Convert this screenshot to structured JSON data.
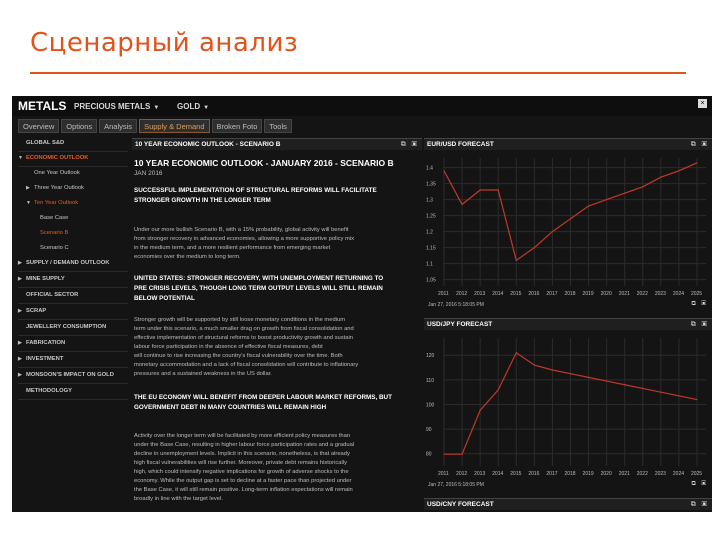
{
  "slide": {
    "title": "Сценарный анализ"
  },
  "app": {
    "brand": "METALS",
    "menus": [
      {
        "label": "PRECIOUS METALS"
      },
      {
        "label": "GOLD"
      }
    ],
    "close": "×",
    "tabs": [
      "Overview",
      "Options",
      "Analysis",
      "Supply & Demand",
      "Broken Foto",
      "Tools"
    ],
    "active_tab": 3
  },
  "sidebar": {
    "items": [
      {
        "label": "GLOBAL S&D"
      },
      {
        "label": "ECONOMIC OUTLOOK"
      },
      {
        "label": "One Year Outlook"
      },
      {
        "label": "Three Year Outlook"
      },
      {
        "label": "Ten Year Outlook"
      },
      {
        "label": "Base Case"
      },
      {
        "label": "Scenario B"
      },
      {
        "label": "Scenario C"
      },
      {
        "label": "SUPPLY / DEMAND OUTLOOK"
      },
      {
        "label": "MINE SUPPLY"
      },
      {
        "label": "OFFICIAL SECTOR"
      },
      {
        "label": "SCRAP"
      },
      {
        "label": "JEWELLERY CONSUMPTION"
      },
      {
        "label": "FABRICATION"
      },
      {
        "label": "INVESTMENT"
      },
      {
        "label": "MONSOON'S IMPACT ON GOLD"
      },
      {
        "label": "METHODOLOGY"
      }
    ]
  },
  "article": {
    "panel_title": "10 YEAR ECONOMIC OUTLOOK - SCENARIO B",
    "title": "10 YEAR ECONOMIC OUTLOOK - JANUARY 2016 - SCENARIO B",
    "date": "JAN 2016",
    "blocks": [
      {
        "kind": "h",
        "lines": [
          "SUCCESSFUL IMPLEMENTATION OF STRUCTURAL REFORMS WILL FACILITATE",
          "STRONGER GROWTH IN THE LONGER TERM"
        ]
      },
      {
        "kind": "p",
        "lines": [
          "Under our more bullish Scenario B, with a 15% probability, global activity will benefit",
          "from stronger recovery in advanced economies, allowing a more supportive policy mix",
          "in the medium term, and a more resilient performance from emerging market",
          "economies over the medium to long term."
        ]
      },
      {
        "kind": "h",
        "lines": [
          "UNITED STATES: STRONGER RECOVERY, WITH UNEMPLOYMENT RETURNING TO",
          "PRE CRISIS LEVELS, THOUGH LONG TERM OUTPUT LEVELS WILL STILL REMAIN",
          "BELOW POTENTIAL"
        ]
      },
      {
        "kind": "p",
        "lines": [
          "Stronger growth will be supported by still loose monetary conditions in the medium",
          "term under this scenario, a much smaller drag on growth from fiscal consolidation and",
          "effective implementation of structural reforms to boost productivity growth and sustain",
          "labour force participation in the absence of effective fiscal measures, debt",
          "will continue to rise increasing the country's fiscal vulnerability over the time. Both",
          "monetary accommodation and a lack of fiscal consolidation will contribute to inflationary",
          "pressures and a sustained weakness in the US dollar."
        ]
      },
      {
        "kind": "h",
        "lines": [
          "THE EU ECONOMY WILL BENEFIT FROM DEEPER LABOUR MARKET REFORMS, BUT",
          "GOVERNMENT DEBT IN MANY COUNTRIES WILL REMAIN HIGH"
        ]
      },
      {
        "kind": "p",
        "lines": [
          "Activity over the longer term will be facilitated by more efficient policy measures than",
          "under the Base Case, resulting in higher labour force participation rates and a gradual",
          "decline in unemployment levels. Implicit in this scenario, nonetheless, is that already",
          "high fiscal vulnerabilities will rise further. Moreover, private debt remains historically",
          "high, which could intensify negative implications for growth of adverse shocks to the",
          "economy. While the output gap is set to decline at a faster pace than projected under",
          "the Base Case, it will still remain positive. Long-term inflation expectations will remain",
          "broadly in line with the target level."
        ]
      }
    ]
  },
  "charts": [
    {
      "title": "EUR/USD FORECAST",
      "timestamp": "Jan 27, 2016 5:18:05 PM",
      "chart_data": {
        "type": "line",
        "title": "EUR/USD FORECAST",
        "x": [
          "2011",
          "2012",
          "2013",
          "2014",
          "2015",
          "2016",
          "2017",
          "2018",
          "2019",
          "2020",
          "2021",
          "2022",
          "2023",
          "2024",
          "2025"
        ],
        "series": [
          {
            "values": [
              1.39,
              1.285,
              1.33,
              1.33,
              1.11,
              1.15,
              1.2,
              1.24,
              1.28,
              1.3,
              1.32,
              1.34,
              1.37,
              1.39,
              1.415
            ]
          }
        ],
        "yticks": [
          "1.4",
          "1.35",
          "1.3",
          "1.25",
          "1.2",
          "1.15",
          "1.1",
          "1.05"
        ],
        "ylim": [
          1.03,
          1.43
        ],
        "xlim": [
          2011,
          2025.5
        ],
        "color": "#c0392b",
        "grid": true
      }
    },
    {
      "title": "USD/JPY FORECAST",
      "timestamp": "Jan 27, 2016 5:18:05 PM",
      "chart_data": {
        "type": "line",
        "title": "USD/JPY FORECAST",
        "x": [
          "2011",
          "2012",
          "2013",
          "2014",
          "2015",
          "2016",
          "2017",
          "2018",
          "2019",
          "2020",
          "2021",
          "2022",
          "2023",
          "2024",
          "2025"
        ],
        "series": [
          {
            "values": [
              79.8,
              79.8,
              97.6,
              105.9,
              121.0,
              116.0,
              114.0,
              112.5,
              111.0,
              109.5,
              108.0,
              106.5,
              105.0,
              103.5,
              102.0
            ]
          }
        ],
        "yticks": [
          "120",
          "110",
          "100",
          "90",
          "80"
        ],
        "ylim": [
          75,
          127
        ],
        "xlim": [
          2011,
          2025.5
        ],
        "color": "#c0392b",
        "grid": true
      }
    },
    {
      "title": "USD/CNY FORECAST"
    }
  ],
  "ui": {
    "panel_tools": "⧉ ▣"
  }
}
